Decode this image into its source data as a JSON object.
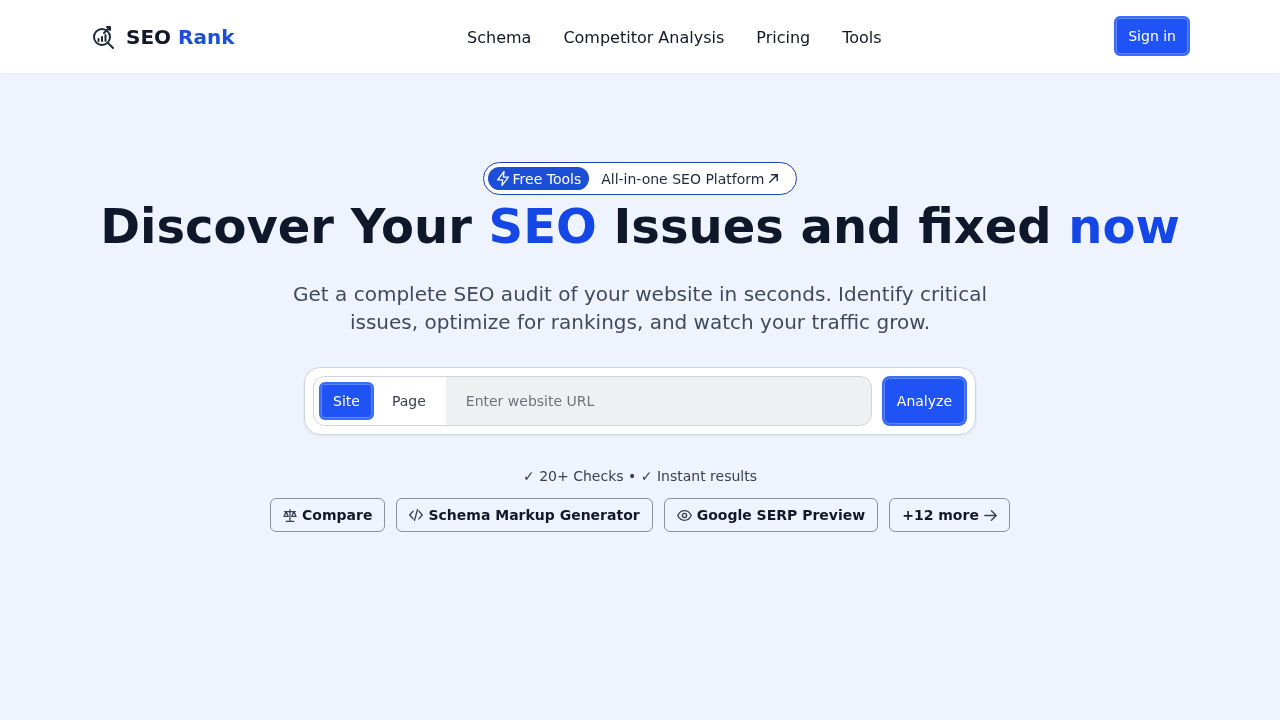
{
  "header": {
    "logo": [
      {
        "text": "SEO ",
        "highlight": false
      },
      {
        "text": "Rank",
        "highlight": true
      }
    ],
    "nav": [
      "Schema",
      "Competitor Analysis",
      "Pricing",
      "Tools"
    ],
    "sign_in": "Sign in"
  },
  "hero": {
    "badge": {
      "tag": "Free Tools",
      "link": "All-in-one SEO Platform"
    },
    "heading": [
      {
        "text": "Discover Your ",
        "highlight": false
      },
      {
        "text": "SEO",
        "highlight": true
      },
      {
        "text": " Issues and fixed ",
        "highlight": false
      },
      {
        "text": "now",
        "highlight": true
      }
    ],
    "subtitle": "Get a complete SEO audit of your website in seconds. Identify critical issues, optimize for rankings, and watch your traffic grow.",
    "search": {
      "modes": [
        {
          "label": "Site",
          "selected": true
        },
        {
          "label": "Page",
          "selected": false
        }
      ],
      "placeholder": "Enter website URL",
      "button": "Analyze"
    },
    "features": "✓ 20+ Checks • ✓ Instant results",
    "tools": [
      {
        "label": "Compare",
        "kind": "compare"
      },
      {
        "label": "Schema Markup Generator",
        "kind": "schema"
      },
      {
        "label": "Google SERP Preview",
        "kind": "preview"
      },
      {
        "label": "+12 more",
        "kind": "more"
      }
    ]
  }
}
